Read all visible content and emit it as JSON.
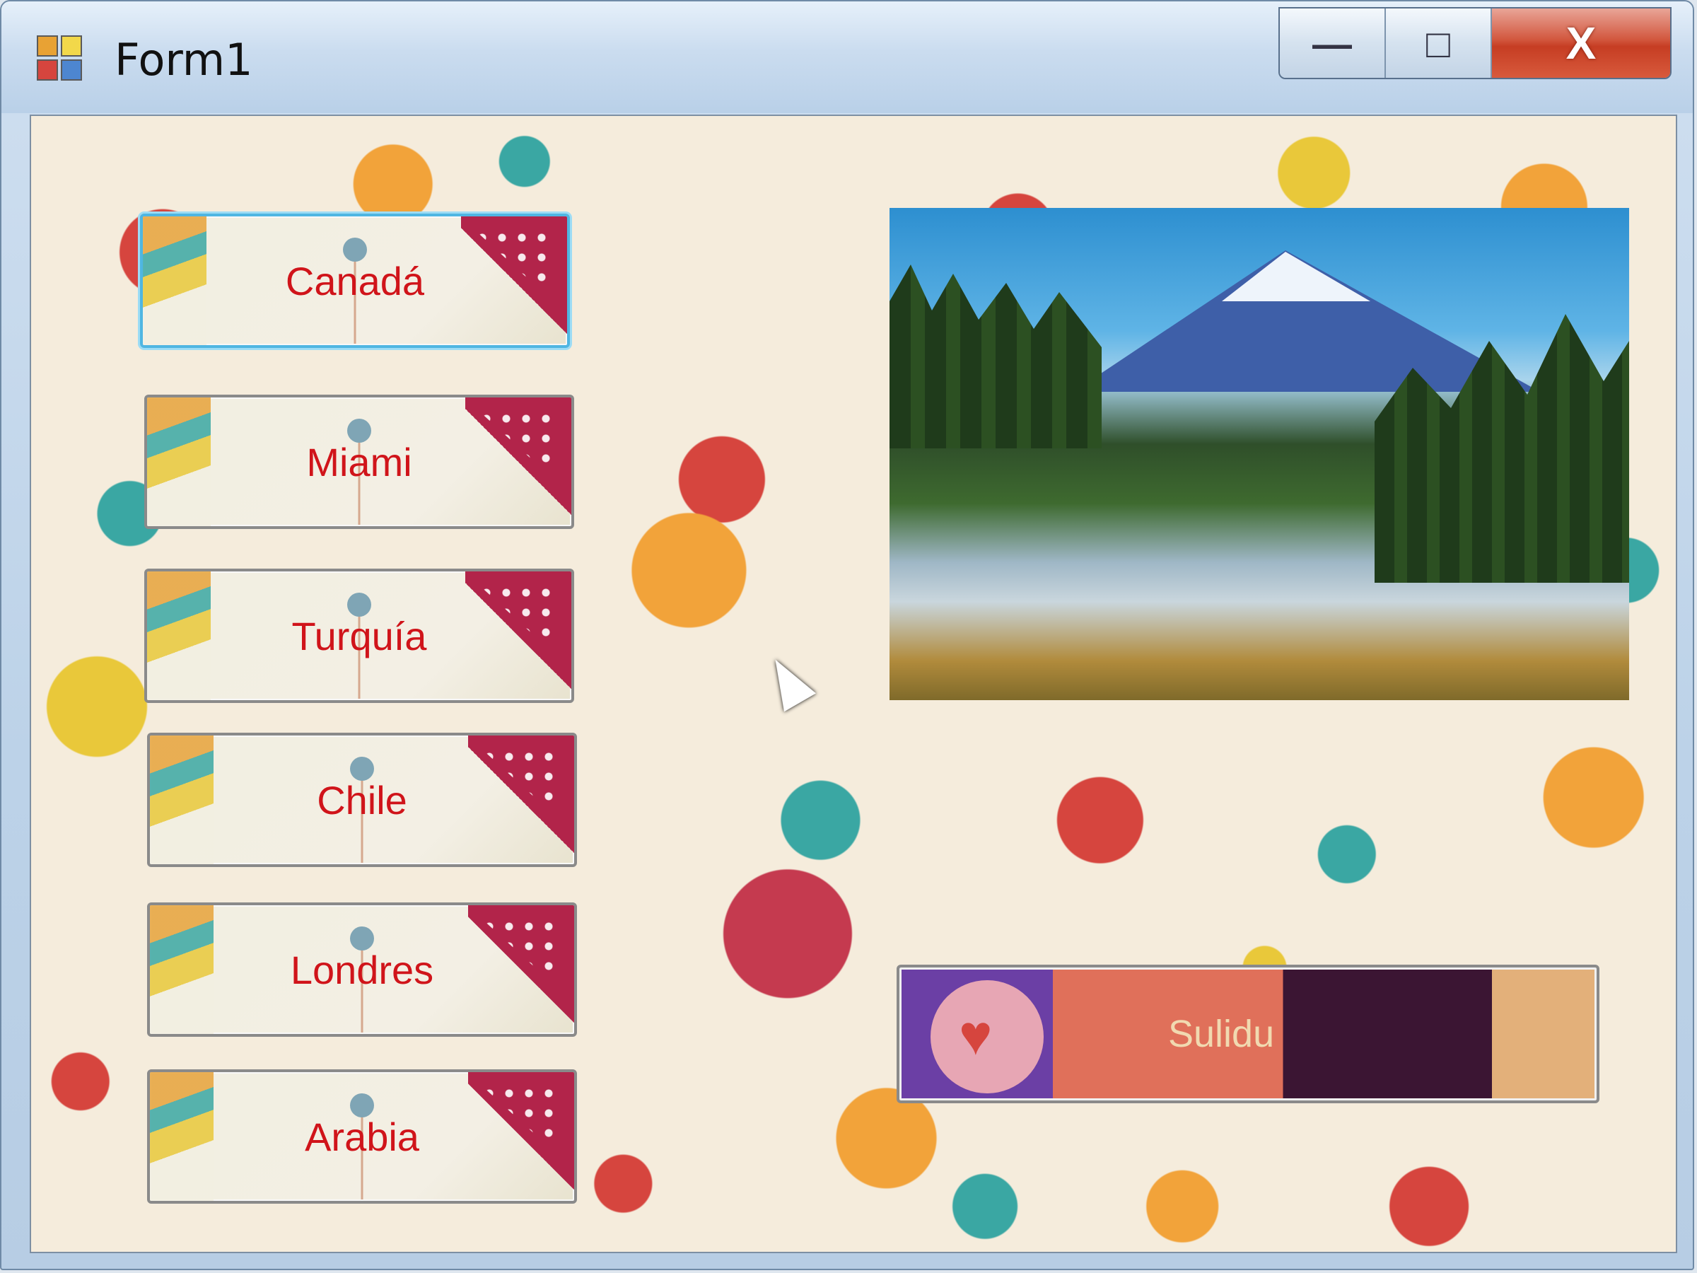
{
  "window": {
    "title": "Form1",
    "icon": "winforms-app-icon",
    "controls": {
      "minimize": "—",
      "maximize": "□",
      "close": "X"
    }
  },
  "buttons": [
    {
      "label": "Canadá"
    },
    {
      "label": "Miami"
    },
    {
      "label": "Turquía"
    },
    {
      "label": "Chile"
    },
    {
      "label": "Londres"
    },
    {
      "label": "Arabia"
    }
  ],
  "picture": {
    "subject": "mountain-lake-landscape"
  },
  "sound_button": {
    "label": "Sulidu"
  },
  "colors": {
    "button_text": "#d0141a",
    "focus_border": "#4fb6e2",
    "close_button": "#c63d23"
  }
}
